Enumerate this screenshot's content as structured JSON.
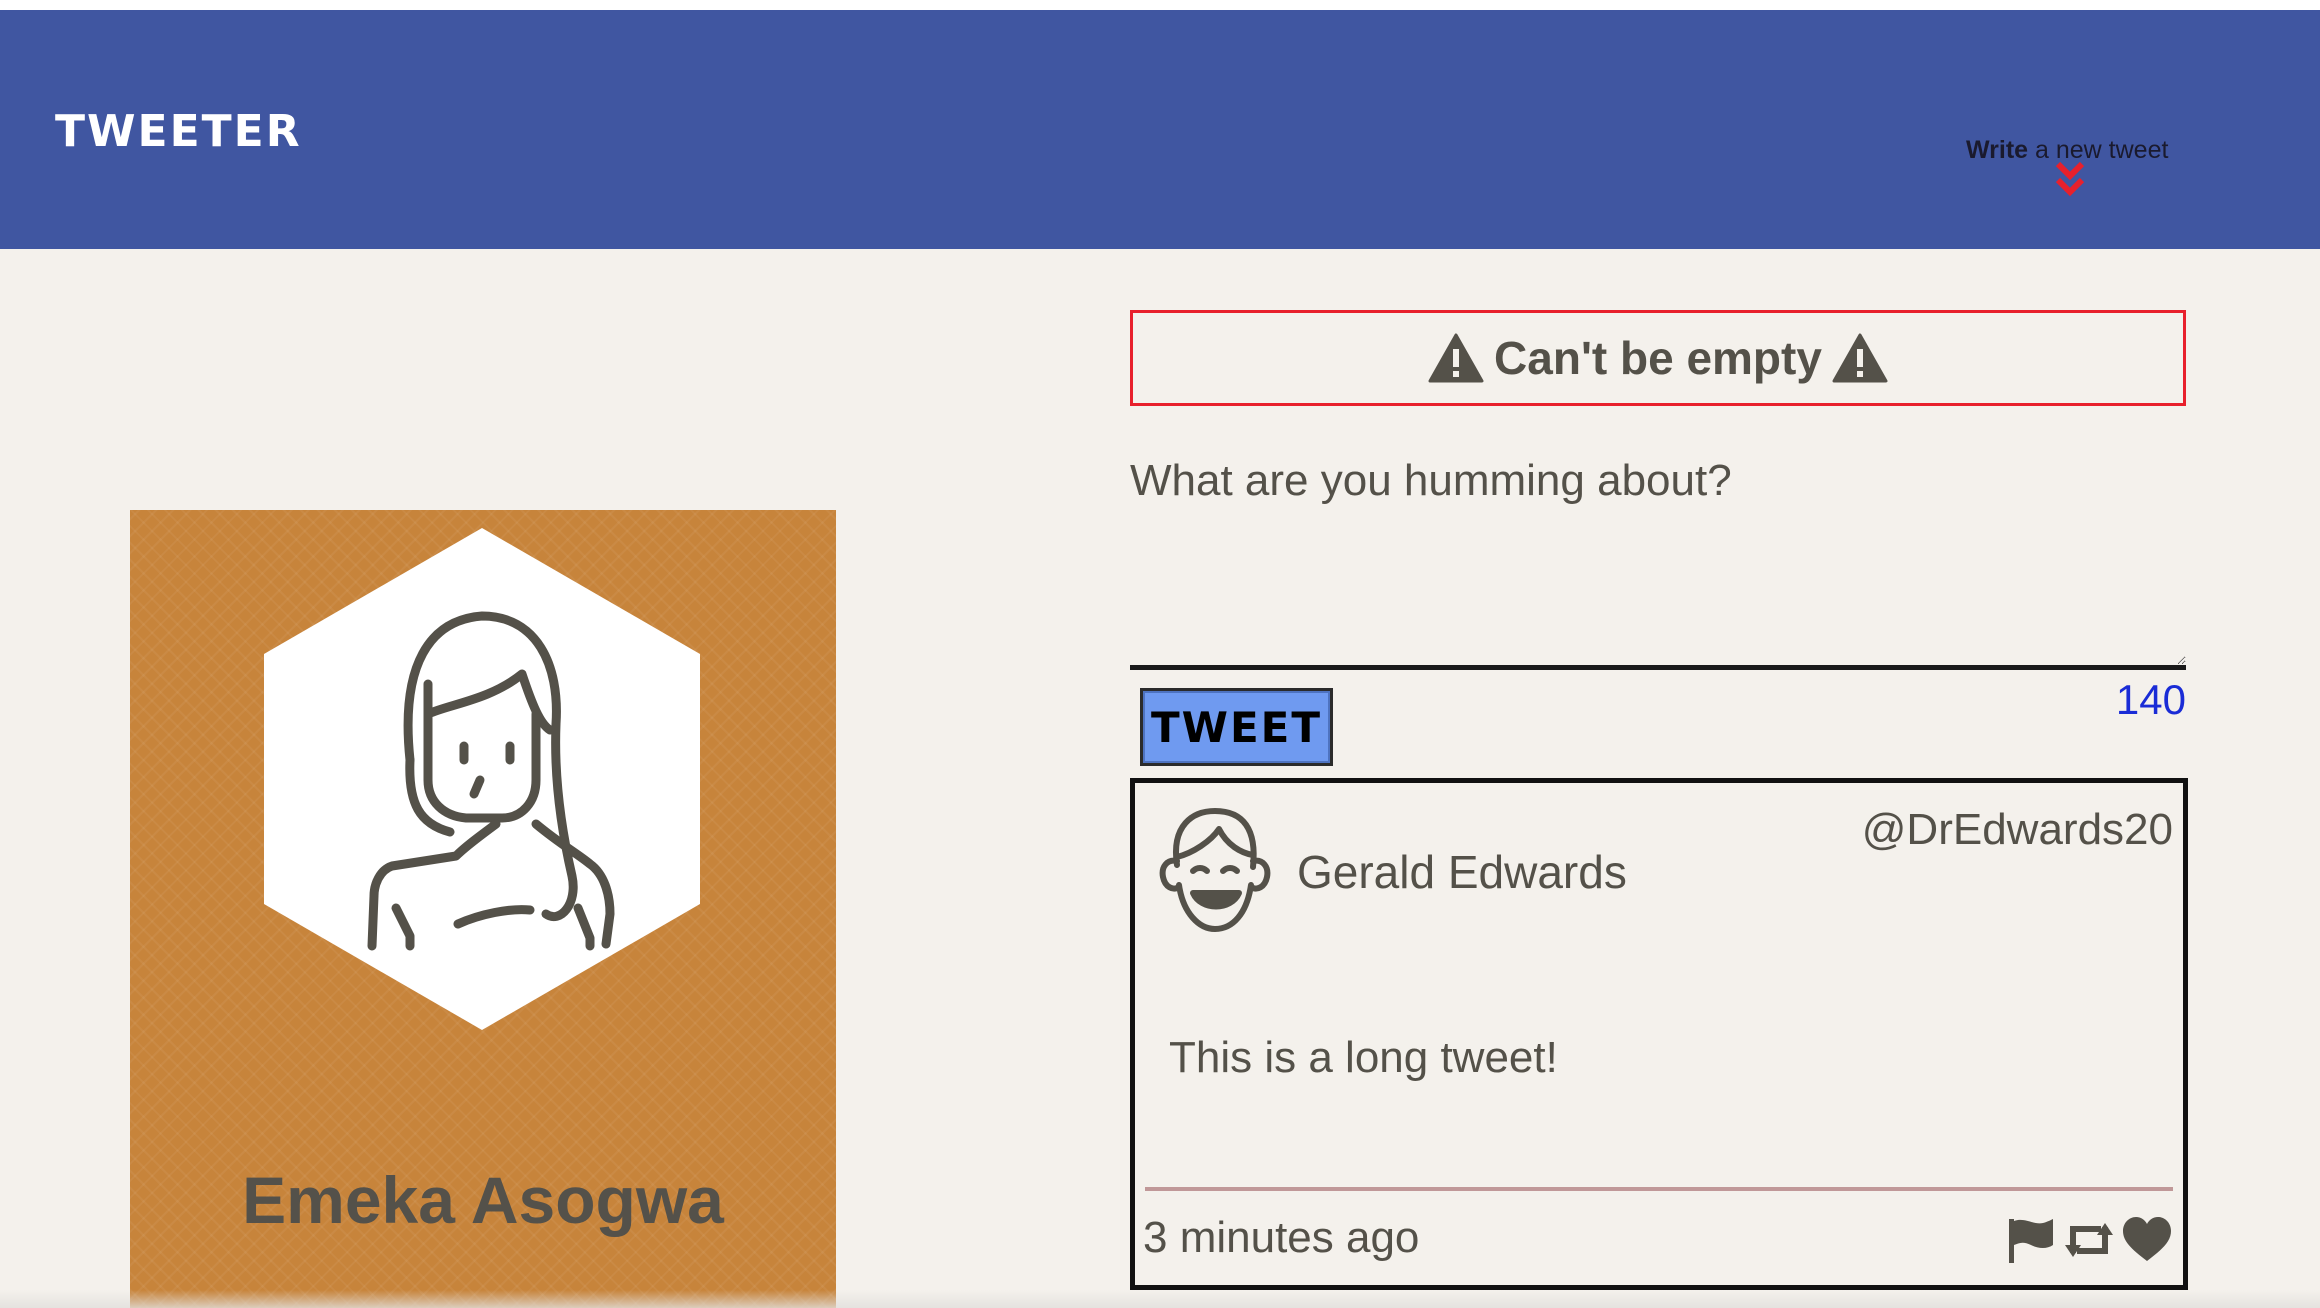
{
  "nav": {
    "brand": "TWEETER",
    "compose_bold": "Write",
    "compose_rest": " a new tweet",
    "compose_icon": "double-chevron-down-icon"
  },
  "profile": {
    "name": "Emeka Asogwa",
    "avatar_icon": "female-avatar-icon",
    "background_color": "#c7843b"
  },
  "composer": {
    "error_text": "Can't be empty",
    "error_icon": "warning-icon",
    "placeholder": "What are you humming about?",
    "button_label": "TWEET",
    "counter": "140"
  },
  "tweet": {
    "author": "Gerald Edwards",
    "handle": "@DrEdwards20",
    "body": "This is a long tweet!",
    "time": "3 minutes ago",
    "avatar_icon": "male-avatar-icon",
    "actions": [
      "flag-icon",
      "retweet-icon",
      "heart-icon"
    ]
  },
  "colors": {
    "nav": "#4056a1",
    "error_border": "#e8202c",
    "button": "#6f9af0",
    "counter": "#1a2cd6",
    "accent_chevron": "#e8202c"
  }
}
